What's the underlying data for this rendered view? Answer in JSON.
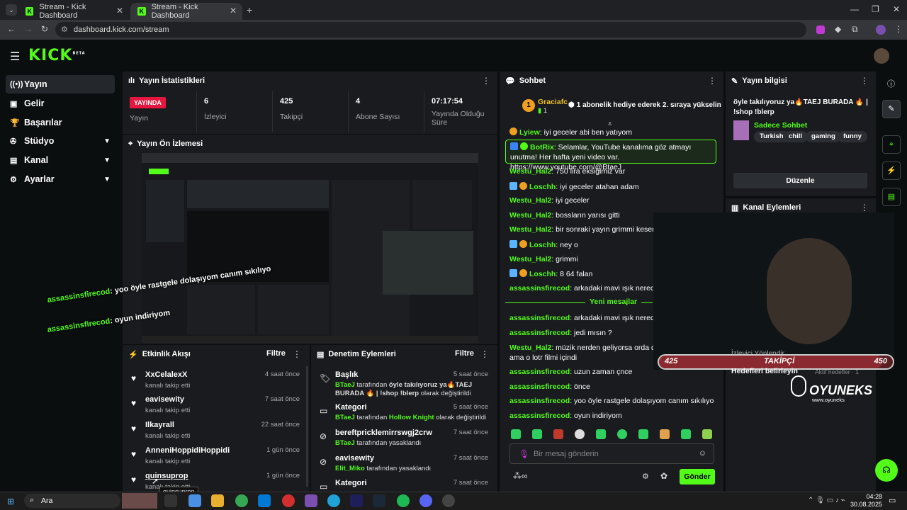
{
  "browser": {
    "tabs": [
      {
        "title": "Stream - Kick Dashboard"
      },
      {
        "title": "Stream - Kick Dashboard"
      }
    ],
    "url": "dashboard.kick.com/stream"
  },
  "brand": {
    "logo": "KICK",
    "beta": "BETA",
    "accent": "#53fc18"
  },
  "sidebar": {
    "items": [
      {
        "label": "Yayın",
        "icon": "broadcast-icon",
        "active": true
      },
      {
        "label": "Gelir",
        "icon": "revenue-icon"
      },
      {
        "label": "Başarılar",
        "icon": "trophy-icon"
      },
      {
        "label": "Stüdyo",
        "icon": "studio-icon",
        "expandable": true
      },
      {
        "label": "Kanal",
        "icon": "channel-icon",
        "expandable": true
      },
      {
        "label": "Ayarlar",
        "icon": "gear-icon",
        "expandable": true
      }
    ]
  },
  "stats": {
    "title": "Yayın İstatistikleri",
    "live_badge": "YAYINDA",
    "live_label": "Yayın",
    "items": [
      {
        "value": "6",
        "label": "İzleyici"
      },
      {
        "value": "425",
        "label": "Takipçi"
      },
      {
        "value": "4",
        "label": "Abone Sayısı"
      },
      {
        "value": "07:17:54",
        "label": "Yayında Olduğu Süre"
      }
    ]
  },
  "preview": {
    "title": "Yayın Ön İzlemesi",
    "overlay_lines": [
      {
        "user": "assassinsfirecod",
        "text": ": yoo öyle rastgele dolaşıyom canım sıkılıyo"
      },
      {
        "user": "assassinsfirecod",
        "text": ": oyun indiriyom"
      }
    ]
  },
  "activity": {
    "title": "Etkinlik Akışı",
    "filter": "Filtre",
    "items": [
      {
        "name": "XxCelalexX",
        "sub": "kanalı takip etti",
        "time": "4 saat önce"
      },
      {
        "name": "eavisewity",
        "sub": "kanalı takip etti",
        "time": "7 saat önce"
      },
      {
        "name": "Ilkayrall",
        "sub": "kanalı takip etti",
        "time": "22 saat önce"
      },
      {
        "name": "AnneniHoppidiHoppidi",
        "sub": "kanalı takip etti",
        "time": "1 gün önce"
      },
      {
        "name": "quinsuprop",
        "sub": "kanalı takip etti",
        "time": "1 gün önce"
      }
    ],
    "tooltip": "quinsuprop"
  },
  "moderation": {
    "title": "Denetim Eylemleri",
    "filter": "Filtre",
    "items": [
      {
        "icon": "tag-icon",
        "name": "Başlık",
        "time": "5 saat önce",
        "actor": "BTaeJ",
        "mid": " tarafından ",
        "value": "öyle takılıyoruz ya🔥TAEJ BURADA 🔥 | !shop !blerp",
        "end": " olarak değiştirildi"
      },
      {
        "icon": "category-icon",
        "name": "Kategori",
        "time": "5 saat önce",
        "actor": "BTaeJ",
        "mid": " tarafından ",
        "value": "Hollow Knight",
        "end": " olarak değiştirildi"
      },
      {
        "icon": "ban-icon",
        "name": "bereftpricklemirrswgj2crw",
        "time": "7 saat önce",
        "actor": "BTaeJ",
        "mid": " tarafından yasaklandı",
        "value": "",
        "end": ""
      },
      {
        "icon": "ban-icon",
        "name": "eavisewity",
        "time": "7 saat önce",
        "actor": "Elit_Miko",
        "mid": " tarafından yasaklandı",
        "value": "",
        "end": ""
      },
      {
        "icon": "category-icon",
        "name": "Kategori",
        "time": "7 saat önce",
        "actor": "",
        "mid": "",
        "value": "",
        "end": ""
      }
    ]
  },
  "chat": {
    "title": "Sohbet",
    "pinned_user": "Graciafc",
    "pinned_count": "1",
    "pinned_text": "1 abonelik hediye ederek 2. sıraya yükselin",
    "messages": [
      {
        "user": "Lyiew",
        "text": ": iyi geceler abi ben yatıyom"
      },
      {
        "user": "BotRix",
        "text": ": Selamlar, YouTube kanalıma göz atmayı unutma! Her hafta yeni video var. https://www.youtube.com/@BtaeJ",
        "highlight": true
      },
      {
        "user": "Westu_Hal2",
        "text": ": 750 lira eksiğimiz var"
      },
      {
        "user": "Loschh",
        "text": ": iyi geceler atahan adam"
      },
      {
        "user": "Westu_Hal2",
        "text": ": iyi geceler"
      },
      {
        "user": "Westu_Hal2",
        "text": ": bossların yarısı gitti"
      },
      {
        "user": "Westu_Hal2",
        "text": ": bir sonraki yayın grimmi keseriz"
      },
      {
        "user": "Loschh",
        "text": ": ney o"
      },
      {
        "user": "Westu_Hal2",
        "text": ": grimmi"
      },
      {
        "user": "Loschh",
        "text": ": 8 64 falan"
      },
      {
        "user": "assassinsfirecod",
        "text": ": arkadaki mavi ışık nereden geli"
      },
      {
        "user": "assassinsfirecod",
        "text": ": arkadaki mavi ışık nereden geli"
      },
      {
        "user": "assassinsfirecod",
        "text": ": jedi mısın ?"
      },
      {
        "user": "Westu_Hal2",
        "text": ": müzik nerden geliyorsa orda diye epik"
      },
      {
        "user": "",
        "text": "ama o lotr filmi içindi"
      },
      {
        "user": "assassinsfirecod",
        "text": ": uzun zaman çnce"
      },
      {
        "user": "assassinsfirecod",
        "text": ": önce"
      },
      {
        "user": "assassinsfirecod",
        "text": ": yoo öyle rastgele dolaşıyom canım sıkılıyo"
      },
      {
        "user": "assassinsfirecod",
        "text": ": oyun indiriyom"
      }
    ],
    "new_messages": "Yeni mesajlar",
    "input_placeholder": "Bir mesaj gönderin",
    "send": "Gönder"
  },
  "stream_info": {
    "title": "Yayın bilgisi",
    "stream_title": "öyle takılıyoruz ya🔥TAEJ BURADA 🔥 | !shop !blerp",
    "category": "Sadece Sohbet",
    "tags": [
      "Turkish",
      "chill",
      "gaming",
      "funny"
    ],
    "edit": "Düzenle"
  },
  "channel_actions": {
    "title": "Kanal Eylemleri"
  },
  "overlay": {
    "followers_left": "425",
    "followers_label": "TAKİPÇİ",
    "followers_right": "450",
    "behind_text1": "İzleyici Yönlendir",
    "behind_text2": "Hedefleri belirleyin",
    "behind_text3": "Aktif hedefler · 1",
    "brand": "OYUNEKS",
    "brand_site": "www.oyuneks"
  },
  "taskbar": {
    "search": "Ara",
    "time": "04:28",
    "date": "30.08.2025"
  }
}
